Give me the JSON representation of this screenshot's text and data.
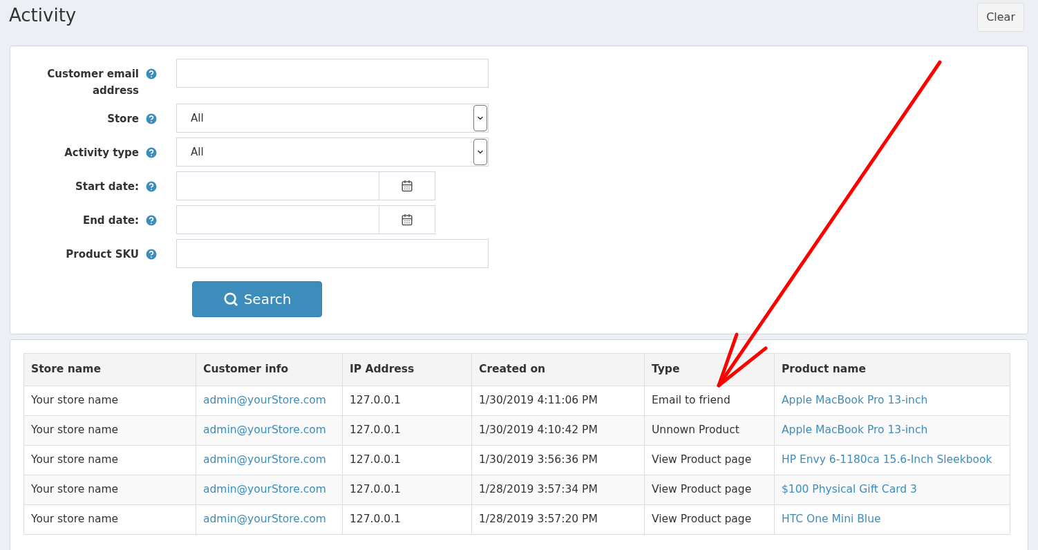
{
  "title": "Activity",
  "clear_button": "Clear",
  "filters": [
    {
      "label": "Customer email address",
      "kind": "text"
    },
    {
      "label": "Store",
      "kind": "select",
      "value": "All"
    },
    {
      "label": "Activity type",
      "kind": "select",
      "value": "All"
    },
    {
      "label": "Start date:",
      "kind": "date"
    },
    {
      "label": "End date:",
      "kind": "date"
    },
    {
      "label": "Product SKU",
      "kind": "text"
    }
  ],
  "search_button": "Search",
  "table": {
    "columns": [
      "Store name",
      "Customer info",
      "IP Address",
      "Created on",
      "Type",
      "Product name"
    ],
    "rows": [
      [
        "Your store name",
        "admin@yourStore.com",
        "127.0.0.1",
        "1/30/2019 4:11:06 PM",
        "Email to friend",
        "Apple MacBook Pro 13-inch"
      ],
      [
        "Your store name",
        "admin@yourStore.com",
        "127.0.0.1",
        "1/30/2019 4:10:42 PM",
        "Unnown Product",
        "Apple MacBook Pro 13-inch"
      ],
      [
        "Your store name",
        "admin@yourStore.com",
        "127.0.0.1",
        "1/30/2019 3:56:36 PM",
        "View Product page",
        "HP Envy 6-1180ca 15.6-Inch Sleekbook"
      ],
      [
        "Your store name",
        "admin@yourStore.com",
        "127.0.0.1",
        "1/28/2019 3:57:34 PM",
        "View Product page",
        "$100 Physical Gift Card 3"
      ],
      [
        "Your store name",
        "admin@yourStore.com",
        "127.0.0.1",
        "1/28/2019 3:57:20 PM",
        "View Product page",
        "HTC One Mini Blue"
      ]
    ]
  }
}
